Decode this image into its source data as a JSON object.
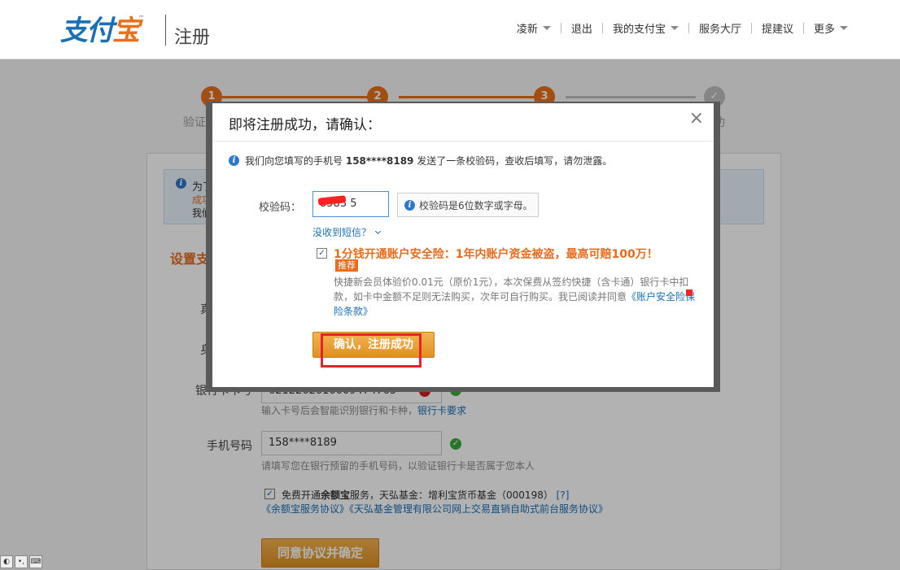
{
  "header": {
    "logo_part1": "支付",
    "logo_part2": "宝",
    "logo_tm": "™",
    "page_title": "注册",
    "nav": [
      {
        "label": "凌新",
        "dropdown": true
      },
      {
        "label": "退出",
        "dropdown": false
      },
      {
        "label": "我的支付宝",
        "dropdown": true
      },
      {
        "label": "服务大厅",
        "dropdown": false
      },
      {
        "label": "提建议",
        "dropdown": false
      },
      {
        "label": "更多",
        "dropdown": true
      }
    ]
  },
  "steps": {
    "items": [
      {
        "num": "1",
        "label": "验证"
      },
      {
        "num": "2",
        "label": ""
      },
      {
        "num": "3",
        "label": ""
      },
      {
        "num": "✓",
        "label": "功"
      }
    ],
    "colors": {
      "done": "#e8701a",
      "current": "#e8701a",
      "pending": "#bfbfbf"
    }
  },
  "background_form": {
    "tip_line1": "为了",
    "tip_line2": "成功",
    "tip_line3": "我们",
    "section_title": "设置支",
    "label_row1": "真",
    "label_row2": "身",
    "bank_label": "银行卡卡号",
    "bank_value": "6212262010009474765",
    "bank_hint": "输入卡号后会智能识别银行和卡种，",
    "bank_hint_link": "银行卡要求",
    "phone_label": "手机号码",
    "phone_value": "158****8189",
    "phone_hint": "请填写您在银行预留的手机号码，以验证银行卡是否属于您本人",
    "yuebao_text_a": "免费开通",
    "yuebao_text_b": "余额宝",
    "yuebao_text_c": "服务，天弘基金：增利宝货币基金（000198）",
    "yuebao_help": "[?]",
    "yuebao_links": "《余额宝服务协议》《天弘基金管理有限公司网上交易直销自助式前台服务协议》",
    "agree_button": "同意协议并确定"
  },
  "modal": {
    "title": "即将注册成功，请确认：",
    "close": "×",
    "sent_prefix": "我们向您填写的手机号",
    "sent_phone": "158****8189",
    "sent_suffix": "发送了一条校验码，查收后填写，请勿泄露。",
    "code_label": "校验码：",
    "code_value": "8583 5",
    "code_tip": "校验码是6位数字或字母。",
    "no_sms": "没收到短信？",
    "insurance_title": "1分钱开通账户安全险：1年内账户资金被盗，最高可赔100万！",
    "insurance_badge": "推荐",
    "insurance_desc": "快捷新会员体验价0.01元（原价1元），本次保费从签约快捷（含卡通）银行卡中扣款，如卡中金额不足则无法购买，次年可自行购买。我已阅读并同意",
    "insurance_link": "《账户安全险保险条款》",
    "confirm_button": "确认，注册成功"
  },
  "tray": [
    "◐",
    "•,",
    "⌨"
  ]
}
